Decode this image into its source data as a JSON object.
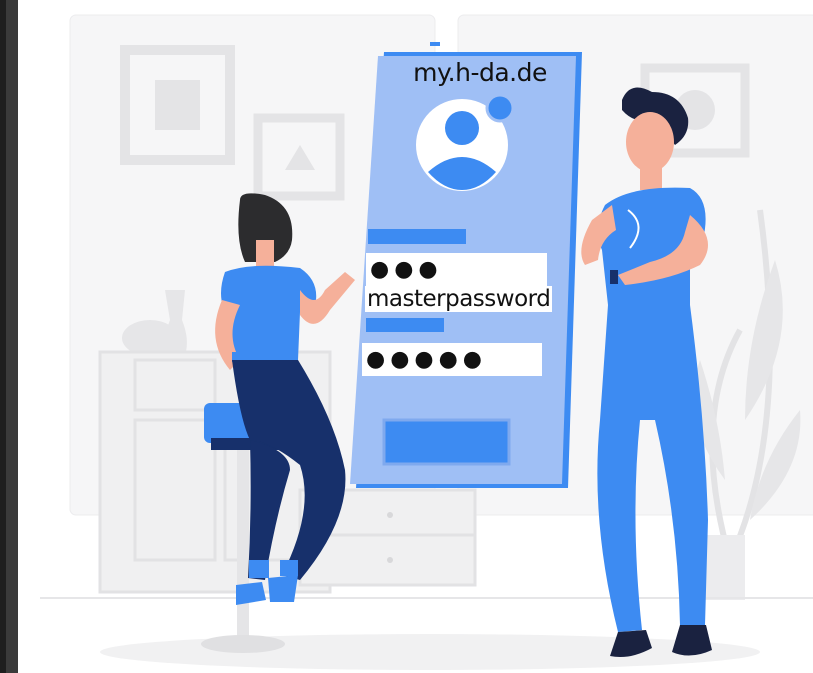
{
  "login_screen": {
    "site": "my.h-da.de",
    "username_value": "●●●",
    "password_label": "masterpassword",
    "password_value": "●●●●●"
  },
  "colors": {
    "accent_blue": "#3d8bf2",
    "phone_light_blue": "#9fbff5",
    "navy": "#17306b",
    "background_gray": "#e9e9ea"
  },
  "icons": [
    "user-avatar-icon",
    "notification-dot-icon"
  ]
}
